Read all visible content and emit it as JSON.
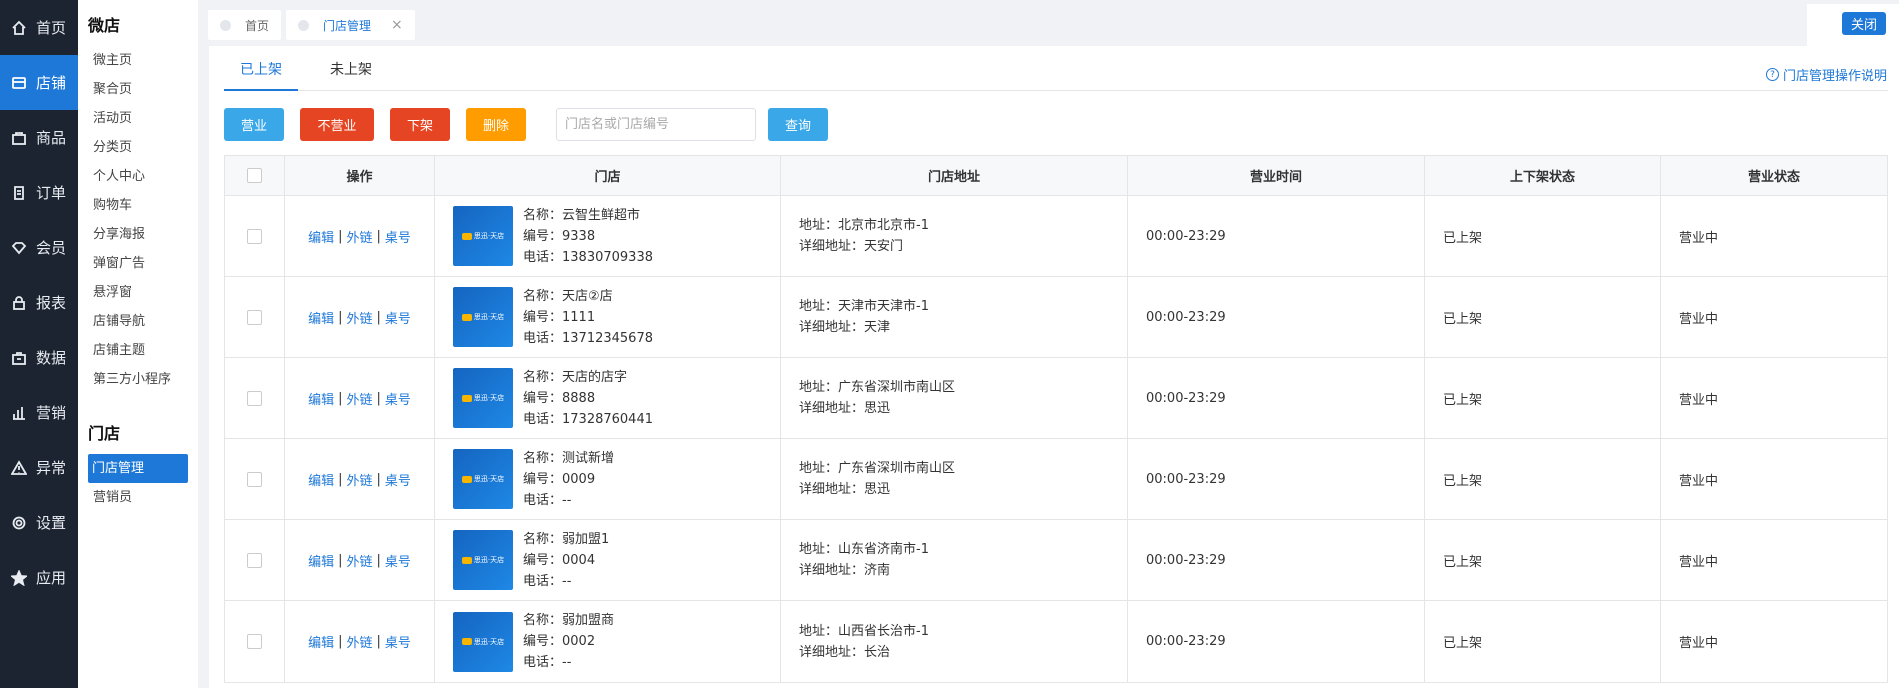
{
  "mainnav": [
    {
      "label": "首页",
      "icon": "home-icon"
    },
    {
      "label": "店铺",
      "icon": "store-icon",
      "active": true
    },
    {
      "label": "商品",
      "icon": "bag-icon"
    },
    {
      "label": "订单",
      "icon": "order-icon"
    },
    {
      "label": "会员",
      "icon": "diamond-icon"
    },
    {
      "label": "报表",
      "icon": "lock-icon"
    },
    {
      "label": "数据",
      "icon": "data-icon"
    },
    {
      "label": "营销",
      "icon": "bar-chart-icon"
    },
    {
      "label": "异常",
      "icon": "warning-icon"
    },
    {
      "label": "设置",
      "icon": "gear-icon"
    },
    {
      "label": "应用",
      "icon": "star-icon"
    }
  ],
  "subnav": {
    "group1_title": "微店",
    "group1_items": [
      "微主页",
      "聚合页",
      "活动页",
      "分类页",
      "个人中心",
      "购物车",
      "分享海报",
      "弹窗广告",
      "悬浮窗",
      "店铺导航",
      "店铺主题",
      "第三方小程序"
    ],
    "group2_title": "门店",
    "group2_items": [
      "门店管理",
      "营销员"
    ]
  },
  "tabs": {
    "home": "首页",
    "store_mgmt": "门店管理",
    "close_x": "×",
    "close_button": "关闭"
  },
  "subtabs": {
    "listed": "已上架",
    "unlisted": "未上架",
    "help": "门店管理操作说明"
  },
  "toolbar": {
    "open": "营业",
    "closed": "不营业",
    "unlist": "下架",
    "delete": "删除",
    "search_placeholder": "门店名或门店编号",
    "query": "查询"
  },
  "colors": {
    "accent": "#1e78d8",
    "btn_blue": "#3aa8e8",
    "btn_red": "#e54522",
    "btn_orange": "#ff9d00",
    "nav_bg": "#1c2431"
  },
  "table": {
    "headers": [
      "操作",
      "门店",
      "门店地址",
      "营业时间",
      "上下架状态",
      "营业状态"
    ],
    "ops": [
      "编辑",
      "外链",
      "桌号"
    ],
    "logo_text": "思迅·天店",
    "rows": [
      {
        "name": "名称：云智生鲜超市",
        "code": "编号：9338",
        "phone": "电话：13830709338",
        "addr": "地址：北京市北京市-1",
        "detail": "详细地址：天安门",
        "hours": "00:00-23:29",
        "shelf": "已上架",
        "status": "营业中"
      },
      {
        "name": "名称：天店②店",
        "code": "编号：1111",
        "phone": "电话：13712345678",
        "addr": "地址：天津市天津市-1",
        "detail": "详细地址：天津",
        "hours": "00:00-23:29",
        "shelf": "已上架",
        "status": "营业中"
      },
      {
        "name": "名称：天店的店字",
        "code": "编号：8888",
        "phone": "电话：17328760441",
        "addr": "地址：广东省深圳市南山区",
        "detail": "详细地址：思迅",
        "hours": "00:00-23:29",
        "shelf": "已上架",
        "status": "营业中"
      },
      {
        "name": "名称：测试新增",
        "code": "编号：0009",
        "phone": "电话：--",
        "addr": "地址：广东省深圳市南山区",
        "detail": "详细地址：思迅",
        "hours": "00:00-23:29",
        "shelf": "已上架",
        "status": "营业中"
      },
      {
        "name": "名称：弱加盟1",
        "code": "编号：0004",
        "phone": "电话：--",
        "addr": "地址：山东省济南市-1",
        "detail": "详细地址：济南",
        "hours": "00:00-23:29",
        "shelf": "已上架",
        "status": "营业中"
      },
      {
        "name": "名称：弱加盟商",
        "code": "编号：0002",
        "phone": "电话：--",
        "addr": "地址：山西省长治市-1",
        "detail": "详细地址：长治",
        "hours": "00:00-23:29",
        "shelf": "已上架",
        "status": "营业中"
      }
    ]
  }
}
